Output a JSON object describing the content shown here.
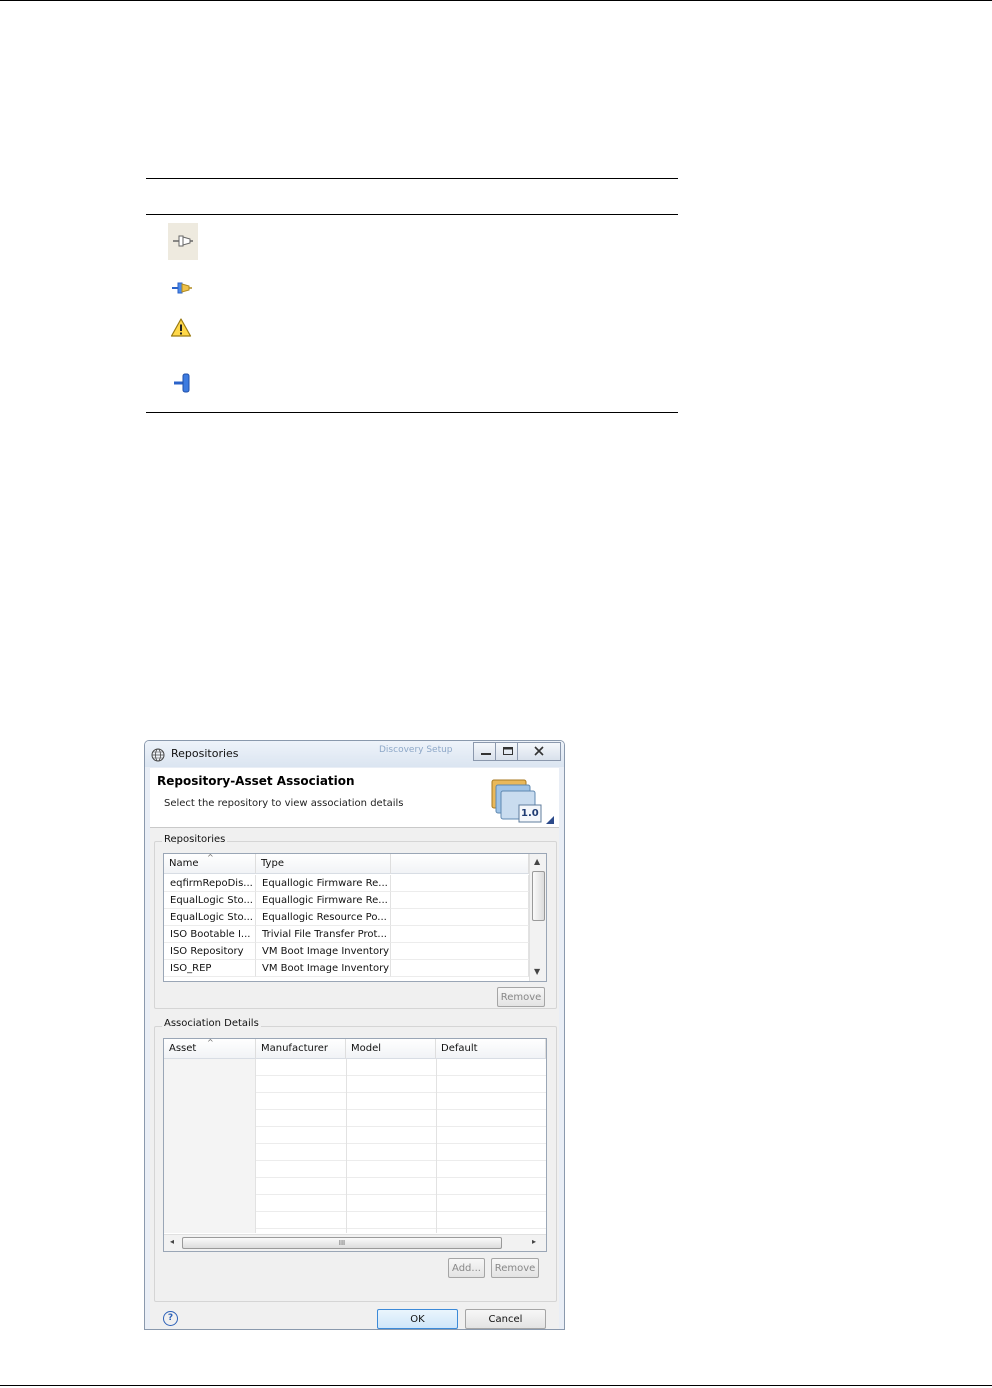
{
  "legend_icons": [
    {
      "icon": "discovery-connector-icon"
    },
    {
      "icon": "active-connector-icon"
    },
    {
      "icon": "warning-icon"
    },
    {
      "icon": "pin-connector-icon"
    }
  ],
  "dialog": {
    "window_title": "Repositories",
    "background_window_text": "Discovery Setup",
    "banner_title": "Repository-Asset Association",
    "banner_subtitle": "Select the repository to view association details",
    "banner_badge": "1.0",
    "repositories_group": "Repositories",
    "repositories_columns": [
      "Name",
      "Type"
    ],
    "repositories_rows": [
      {
        "name": "eqfirmRepoDis...",
        "type": "Equallogic Firmware Re..."
      },
      {
        "name": "EqualLogic Sto...",
        "type": "Equallogic Firmware Re..."
      },
      {
        "name": "EqualLogic Sto...",
        "type": "Equallogic Resource Po..."
      },
      {
        "name": "ISO Bootable I...",
        "type": "Trivial File Transfer Prot..."
      },
      {
        "name": "ISO Repository",
        "type": "VM Boot Image Inventory"
      },
      {
        "name": "ISO_REP",
        "type": "VM Boot Image Inventory"
      }
    ],
    "remove_label": "Remove",
    "association_group": "Association Details",
    "association_columns": [
      "Asset",
      "Manufacturer",
      "Model",
      "Default"
    ],
    "add_label": "Add...",
    "remove2_label": "Remove",
    "help_glyph": "?",
    "ok_label": "OK",
    "cancel_label": "Cancel",
    "scroll_grip": "III"
  }
}
